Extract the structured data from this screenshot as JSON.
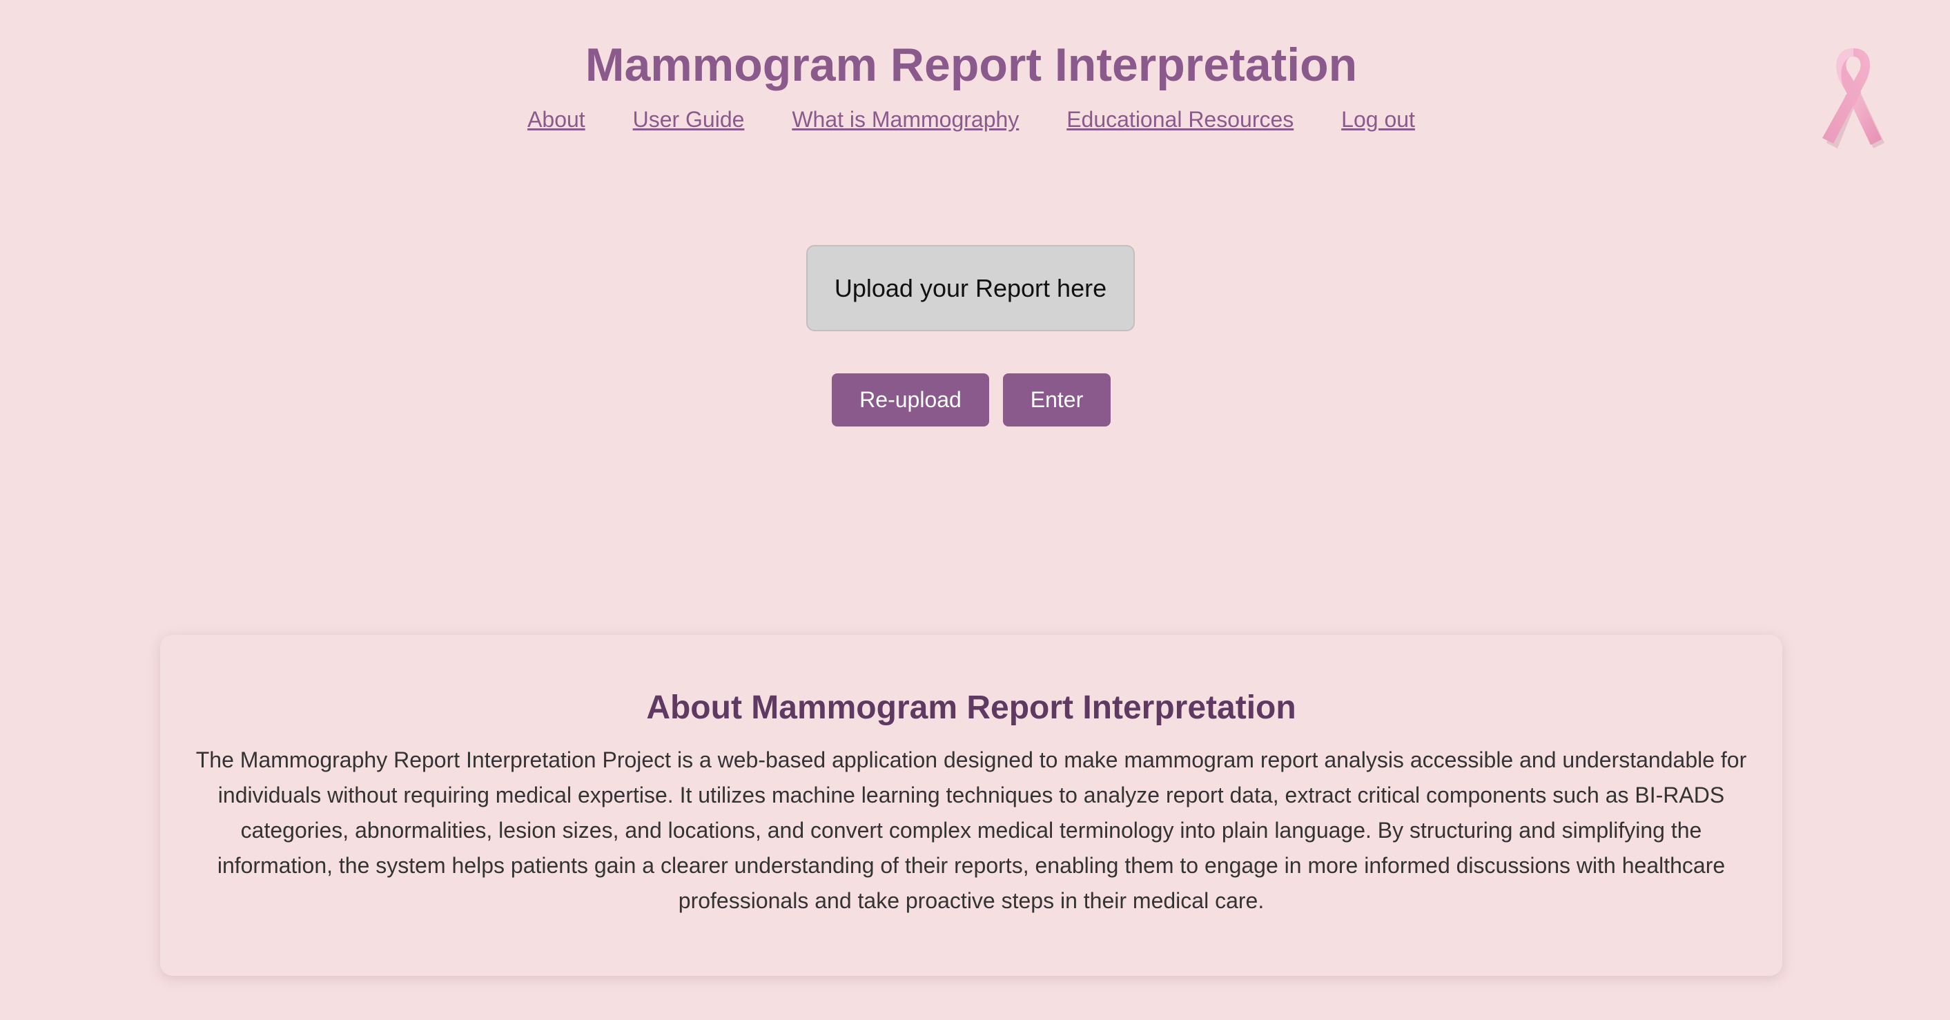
{
  "header": {
    "title": "Mammogram Report Interpretation"
  },
  "nav": {
    "items": [
      {
        "label": "About"
      },
      {
        "label": "User Guide"
      },
      {
        "label": "What is Mammography"
      },
      {
        "label": "Educational Resources"
      },
      {
        "label": "Log out"
      }
    ]
  },
  "logo": {
    "icon": "pink-ribbon-icon",
    "color": "#f2a7c3"
  },
  "upload": {
    "label": "Upload your Report here"
  },
  "actions": {
    "reupload_label": "Re-upload",
    "enter_label": "Enter"
  },
  "about": {
    "title": "About Mammogram Report Interpretation",
    "text": "The Mammography Report Interpretation Project is a web-based application designed to make mammogram report analysis accessible and understandable for individuals without requiring medical expertise. It utilizes machine learning techniques to analyze report data, extract critical components such as BI-RADS categories, abnormalities, lesion sizes, and locations, and convert complex medical terminology into plain language. By structuring and simplifying the information, the system helps patients gain a clearer understanding of their reports, enabling them to engage in more informed discussions with healthcare professionals and take proactive steps in their medical care."
  },
  "colors": {
    "background": "#f6dfe1",
    "accent": "#8b5a8c",
    "heading": "#5e3a62",
    "upload_box": "#d3d3d3"
  }
}
